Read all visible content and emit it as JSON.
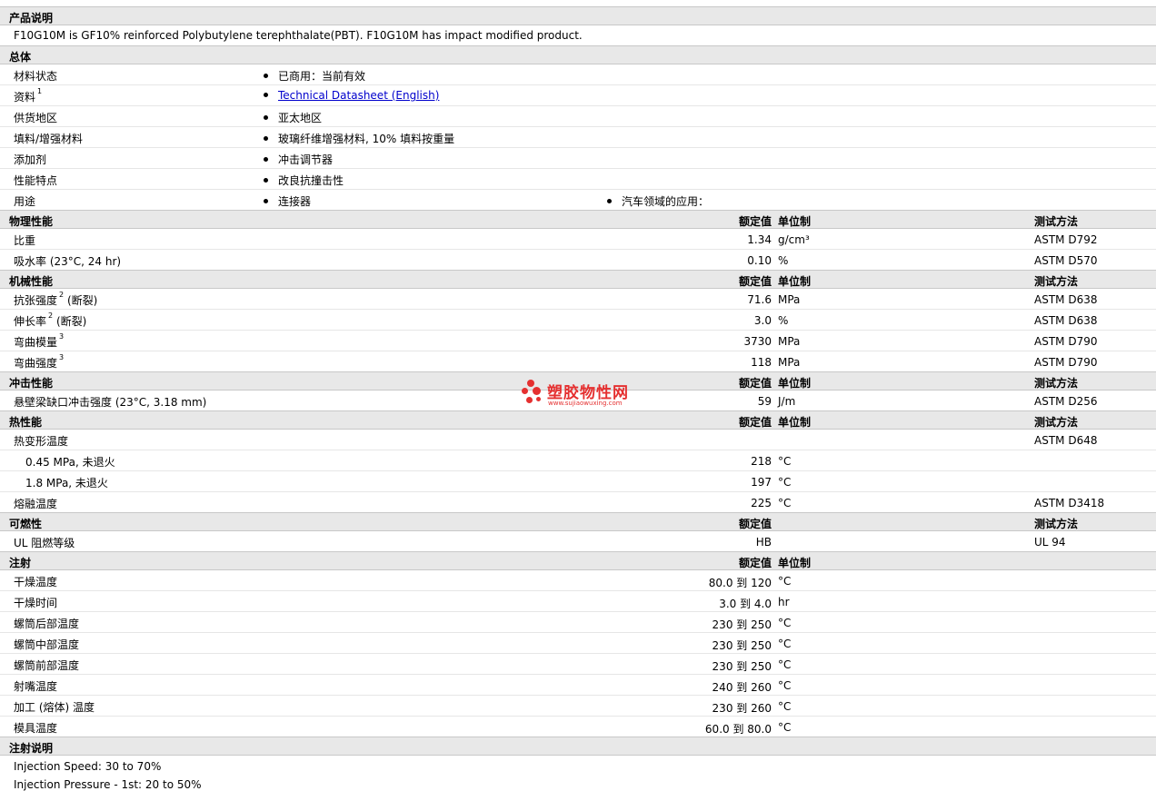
{
  "desc": {
    "title": "产品说明",
    "text": "F10G10M is GF10% reinforced Polybutylene terephthalate(PBT). F10G10M has impact modified product."
  },
  "general": {
    "title": "总体",
    "rows": [
      {
        "label": "材料状态",
        "b1": "已商用：当前有效"
      },
      {
        "label": "资料",
        "sup": "1",
        "b1": "Technical Datasheet (English)"
      },
      {
        "label": "供货地区",
        "b1": "亚太地区"
      },
      {
        "label": "填料/增强材料",
        "b1": "玻璃纤维增强材料, 10% 填料按重量"
      },
      {
        "label": "添加剂",
        "b1": "冲击调节器"
      },
      {
        "label": "性能特点",
        "b1": "改良抗撞击性"
      },
      {
        "label": "用途",
        "b1": "连接器",
        "b2": "汽车领域的应用："
      }
    ]
  },
  "headers": {
    "nominal": "额定值",
    "unit": "单位制",
    "test": "测试方法"
  },
  "physical": {
    "title": "物理性能",
    "rows": [
      {
        "label": "比重",
        "value": "1.34",
        "unit": "g/cm³",
        "test": "ASTM D792"
      },
      {
        "label": "吸水率 (23°C, 24 hr)",
        "value": "0.10",
        "unit": "%",
        "test": "ASTM D570"
      }
    ]
  },
  "mechanical": {
    "title": "机械性能",
    "rows": [
      {
        "label": "抗张强度",
        "sup": "2",
        "label2": "(断裂)",
        "value": "71.6",
        "unit": "MPa",
        "test": "ASTM D638"
      },
      {
        "label": "伸长率",
        "sup": "2",
        "label2": "(断裂)",
        "value": "3.0",
        "unit": "%",
        "test": "ASTM D638"
      },
      {
        "label": "弯曲模量",
        "sup": "3",
        "label2": "",
        "value": "3730",
        "unit": "MPa",
        "test": "ASTM D790"
      },
      {
        "label": "弯曲强度",
        "sup": "3",
        "label2": "",
        "value": "118",
        "unit": "MPa",
        "test": "ASTM D790"
      }
    ]
  },
  "impact": {
    "title": "冲击性能",
    "rows": [
      {
        "label": "悬壁梁缺口冲击强度 (23°C, 3.18 mm)",
        "value": "59",
        "unit": "J/m",
        "test": "ASTM D256"
      }
    ]
  },
  "thermal": {
    "title": "热性能",
    "rows": [
      {
        "label": "热变形温度",
        "value": "",
        "unit": "",
        "test": "ASTM D648"
      },
      {
        "label": "0.45 MPa, 未退火",
        "value": "218",
        "unit": "°C",
        "test": ""
      },
      {
        "label": "1.8 MPa, 未退火",
        "value": "197",
        "unit": "°C",
        "test": ""
      },
      {
        "label": "熔融温度",
        "value": "225",
        "unit": "°C",
        "test": "ASTM D3418"
      }
    ]
  },
  "flammability": {
    "title": "可燃性",
    "rows": [
      {
        "label": "UL 阻燃等级",
        "value": "HB",
        "unit": "",
        "test": "UL 94"
      }
    ]
  },
  "injection": {
    "title": "注射",
    "rows": [
      {
        "label": "干燥温度",
        "value": "80.0 到  120",
        "unit": "°C"
      },
      {
        "label": "干燥时间",
        "value": "3.0 到  4.0",
        "unit": "hr"
      },
      {
        "label": "螺筒后部温度",
        "value": "230 到  250",
        "unit": "°C"
      },
      {
        "label": "螺筒中部温度",
        "value": "230 到  250",
        "unit": "°C"
      },
      {
        "label": "螺筒前部温度",
        "value": "230 到  250",
        "unit": "°C"
      },
      {
        "label": "射嘴温度",
        "value": "240 到  260",
        "unit": "°C"
      },
      {
        "label": "加工 (熔体) 温度",
        "value": "230 到  260",
        "unit": "°C"
      },
      {
        "label": "模具温度",
        "value": "60.0 到  80.0",
        "unit": "°C"
      }
    ]
  },
  "notes": {
    "title": "注射说明",
    "lines": [
      "Injection Speed: 30 to 70%",
      "Injection Pressure - 1st: 20 to 50%"
    ]
  },
  "watermark": {
    "text": "塑胶物性网",
    "url": "www.sujiaowuxing.com",
    "color": "#e53030"
  }
}
